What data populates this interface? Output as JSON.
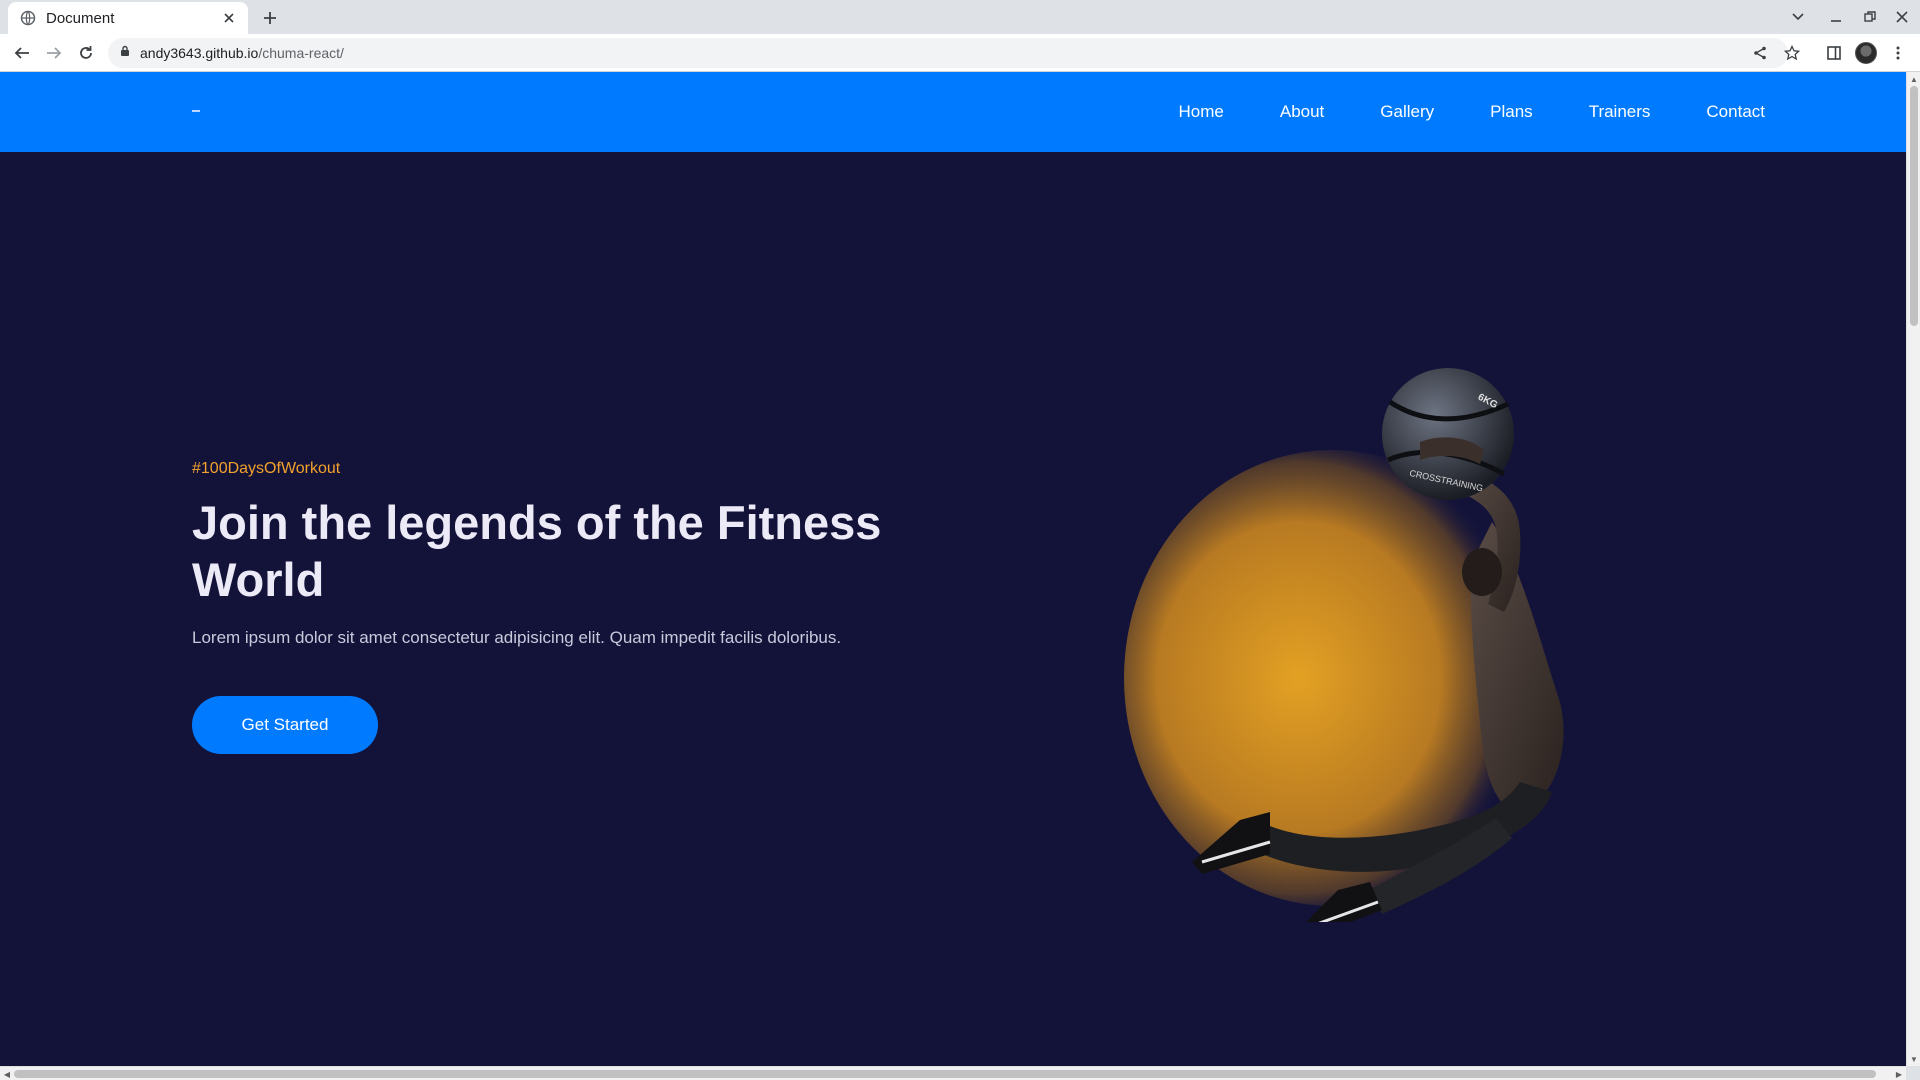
{
  "browser": {
    "tab_title": "Document",
    "url_host": "andy3643.github.io",
    "url_path": "/chuma-react/"
  },
  "nav": {
    "items": [
      "Home",
      "About",
      "Gallery",
      "Plans",
      "Trainers",
      "Contact"
    ]
  },
  "hero": {
    "tag": "#100DaysOfWorkout",
    "title": "Join the legends of the Fitness World",
    "description": "Lorem ipsum dolor sit amet consectetur adipisicing elit. Quam impedit facilis doloribus.",
    "cta_label": "Get Started",
    "ball_text": "CROSSTRAINING",
    "ball_weight": "6KG"
  },
  "colors": {
    "nav_bg": "#007bff",
    "page_bg": "#13133a",
    "accent": "#f2a12b",
    "button": "#007bff"
  },
  "icons": [
    "globe-icon",
    "close-icon",
    "plus-icon",
    "chevron-down-icon",
    "minimize-icon",
    "restore-icon",
    "back-arrow-icon",
    "forward-arrow-icon",
    "reload-icon",
    "lock-icon",
    "share-icon",
    "star-icon",
    "side-panel-icon",
    "kebab-menu-icon"
  ]
}
